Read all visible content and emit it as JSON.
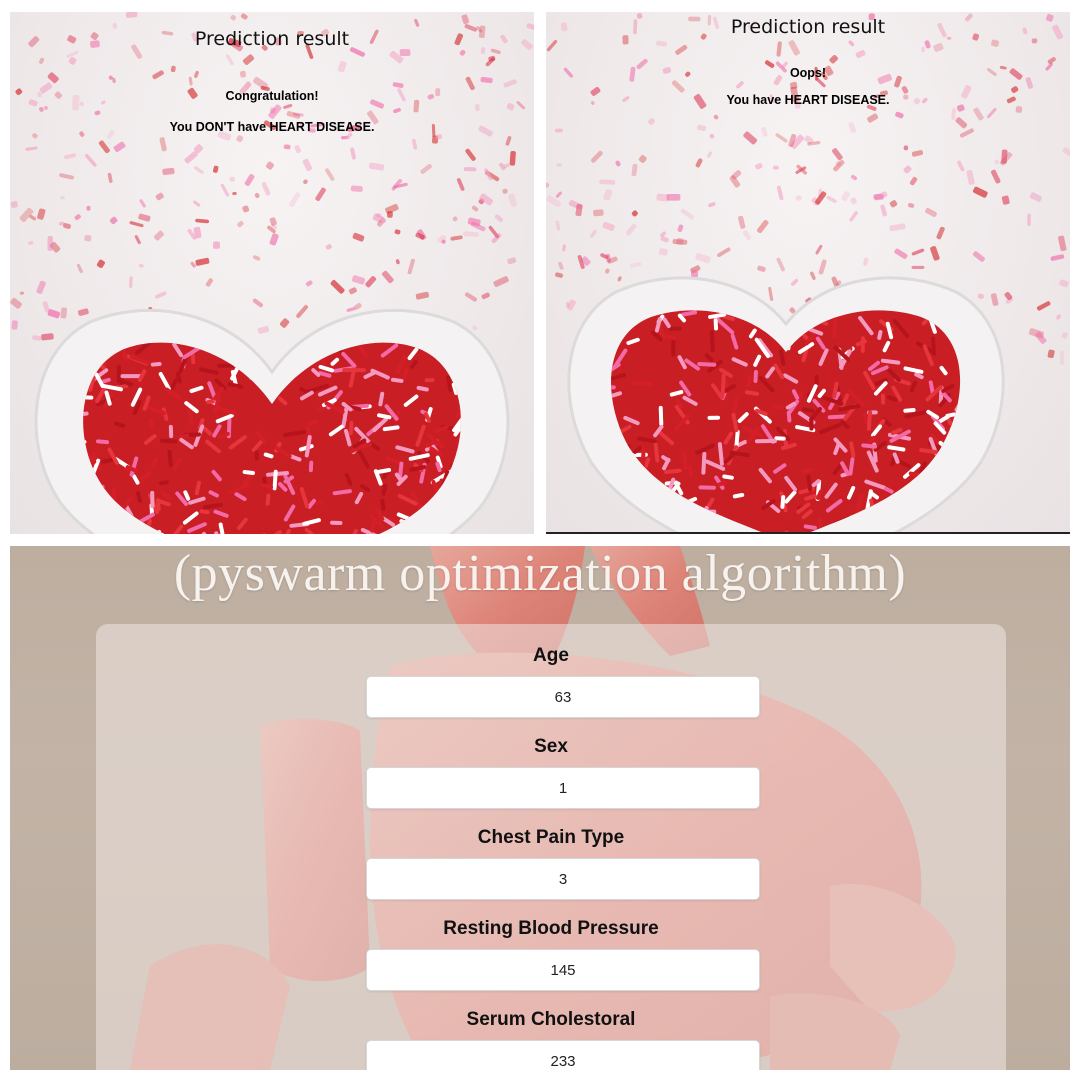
{
  "result_success": {
    "title": "Prediction result",
    "headline": "Congratulation!",
    "message": "You DON'T have HEART DISEASE."
  },
  "result_failure": {
    "title": "Prediction result",
    "headline": "Oops!",
    "message": "You have HEART DISEASE."
  },
  "form": {
    "title": "(pyswarm optimization algorithm)",
    "fields": [
      {
        "label": "Age",
        "value": "63"
      },
      {
        "label": "Sex",
        "value": "1"
      },
      {
        "label": "Chest Pain Type",
        "value": "3"
      },
      {
        "label": "Resting Blood Pressure",
        "value": "145"
      },
      {
        "label": "Serum Cholestoral",
        "value": "233"
      }
    ]
  },
  "colors": {
    "sprinkle_red": "#d42a2e",
    "sprinkle_pink": "#f06aa8",
    "sprinkle_white": "#ffffff",
    "form_bg": "#bdaea0",
    "heart_illustration": "#e8756a"
  },
  "icons": [
    "heart-bowl-image",
    "heart-illustration-image"
  ]
}
